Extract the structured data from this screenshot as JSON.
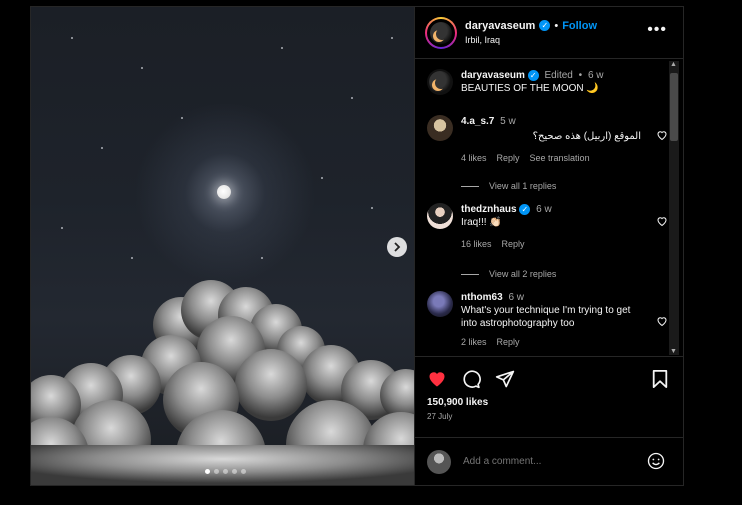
{
  "post": {
    "username": "daryavaseum",
    "follow_label": "Follow",
    "location": "Irbil, Iraq",
    "more_label": "•••",
    "caption": {
      "username": "daryavaseum",
      "edited": "Edited",
      "dot": "•",
      "time": "6 w",
      "text": "BEAUTIES OF THE MOON 🌙"
    },
    "likes": "150,900 likes",
    "date": "27 July",
    "liked": true,
    "image_dots_count": 5,
    "active_dot": 0
  },
  "comments": [
    {
      "username": "4.a_s.7",
      "time": "5 w",
      "text": "الموقع (اربيل) هذه صحيح؟",
      "likes": "4 likes",
      "reply_label": "Reply",
      "translate_label": "See translation",
      "view_replies": "View all 1 replies",
      "verified": false
    },
    {
      "username": "thedznhaus",
      "time": "6 w",
      "text": "Iraq!!! 👏🏻",
      "likes": "16 likes",
      "reply_label": "Reply",
      "view_replies": "View all 2 replies",
      "verified": true
    },
    {
      "username": "nthom63",
      "time": "6 w",
      "text": "What's your technique I'm trying to get into astrophotography too",
      "likes": "2 likes",
      "reply_label": "Reply",
      "verified": false
    }
  ],
  "add_comment": {
    "placeholder": "Add a comment..."
  },
  "colors": {
    "accent": "#0095f6",
    "like": "#ff3040",
    "background": "#000000"
  }
}
